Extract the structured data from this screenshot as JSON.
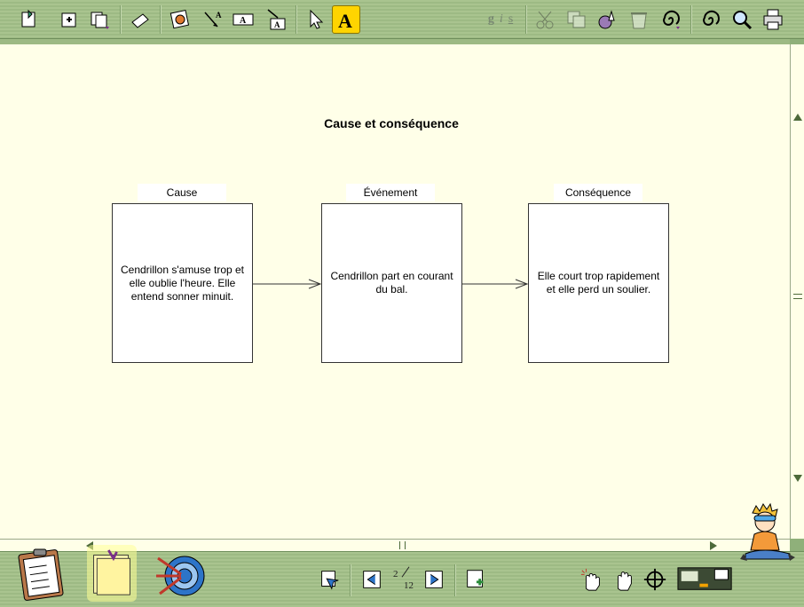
{
  "toolbar": {
    "text_styles": [
      "g",
      "i",
      "s"
    ],
    "active_tool": "text-tool"
  },
  "diagram": {
    "title": "Cause et conséquence",
    "boxes": [
      {
        "label": "Cause",
        "text": "Cendrillon s'amuse trop et elle oublie l'heure. Elle entend sonner minuit."
      },
      {
        "label": "Événement",
        "text": "Cendrillon part en courant du bal."
      },
      {
        "label": "Conséquence",
        "text": "Elle court trop rapidement et elle perd un soulier."
      }
    ]
  },
  "pager": {
    "current": "2",
    "total": "12"
  },
  "colors": {
    "toolbar_green": "#a9c48f",
    "canvas_bg": "#ffffe8",
    "active_tool": "#ffd400"
  }
}
